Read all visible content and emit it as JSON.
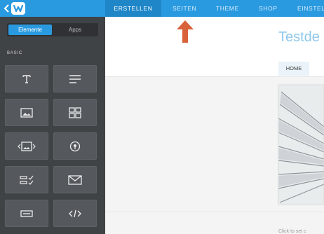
{
  "colors": {
    "accent": "#2a9ae0",
    "accent_dark": "#1f86c8",
    "sidebar_bg": "#404346",
    "tile_bg": "#55585c",
    "arrow": "#d8623a",
    "site_title": "#8ec7ea"
  },
  "header": {
    "back_icon": "chevron-left-icon",
    "logo_icon": "weebly-w-logo",
    "tabs": [
      {
        "label": "ERSTELLEN",
        "active": true
      },
      {
        "label": "SEITEN",
        "active": false
      },
      {
        "label": "THEME",
        "active": false
      },
      {
        "label": "SHOP",
        "active": false
      },
      {
        "label": "EINSTEL",
        "active": false
      }
    ]
  },
  "sidebar": {
    "toggle": [
      {
        "label": "Elemente",
        "active": true
      },
      {
        "label": "Apps",
        "active": false
      }
    ],
    "section_label": "BASIC",
    "elements": [
      {
        "icon": "text-icon"
      },
      {
        "icon": "paragraph-icon"
      },
      {
        "icon": "image-icon"
      },
      {
        "icon": "gallery-icon"
      },
      {
        "icon": "slideshow-icon"
      },
      {
        "icon": "map-pin-icon"
      },
      {
        "icon": "form-icon"
      },
      {
        "icon": "email-icon"
      },
      {
        "icon": "button-icon"
      },
      {
        "icon": "embed-code-icon"
      }
    ]
  },
  "annotation": {
    "icon": "arrow-up-icon"
  },
  "preview": {
    "site_title": "Testde",
    "nav": [
      "HOME"
    ],
    "footer_text": "Click to set c"
  }
}
